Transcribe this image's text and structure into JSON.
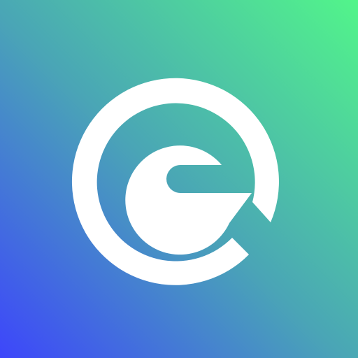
{
  "icon": {
    "name": "letter-e-logo-icon",
    "gradient_top_right": "#52F58A",
    "gradient_middle": "#4AA5B6",
    "gradient_bottom_left": "#3D46FB",
    "logo_color": "#FFFFFF"
  }
}
